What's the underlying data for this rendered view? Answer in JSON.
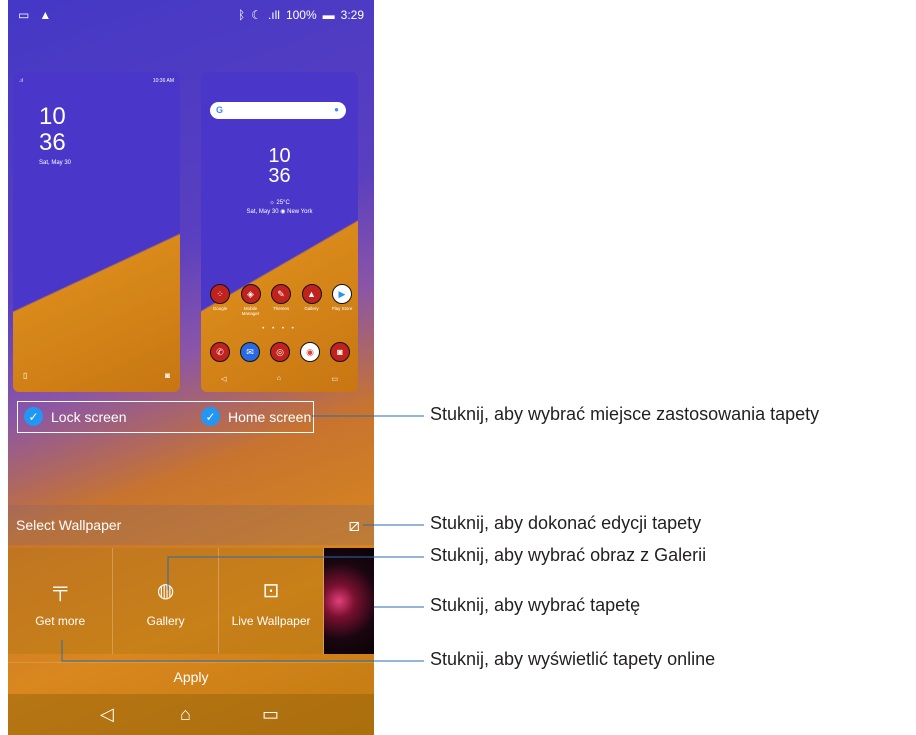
{
  "status_bar": {
    "battery": "100%",
    "time": "3:29"
  },
  "lock_preview": {
    "status_time": "10:36 AM",
    "hour": "10",
    "minute": "36",
    "date": "Sat, May 30"
  },
  "home_preview": {
    "search_logo": "G",
    "hour": "10",
    "minute": "36",
    "weather": "☼ 25°C",
    "date_location": "Sat, May 30 ◉ New York",
    "apps": [
      {
        "label": "Google"
      },
      {
        "label": "Mobile Manager"
      },
      {
        "label": "Themes"
      },
      {
        "label": "Gallery"
      },
      {
        "label": "Play Store"
      }
    ],
    "page_dots": "• • • •"
  },
  "targets": {
    "lock": "Lock screen",
    "home": "Home screen"
  },
  "select_wallpaper": {
    "title": "Select Wallpaper"
  },
  "tiles": {
    "get_more": "Get more",
    "gallery": "Gallery",
    "live": "Live Wallpaper"
  },
  "apply_label": "Apply",
  "callouts": {
    "apply_target": "Stuknij, aby wybrać miejsce zastosowania tapety",
    "edit": "Stuknij, aby dokonać edycji tapety",
    "gallery": "Stuknij, aby wybrać obraz z Galerii",
    "choose": "Stuknij, aby wybrać tapetę",
    "online": "Stuknij, aby wyświetlić tapety online"
  },
  "colors": {
    "check_blue": "#2196f3",
    "purple": "#4a36c8",
    "orange": "#d98a1a"
  }
}
